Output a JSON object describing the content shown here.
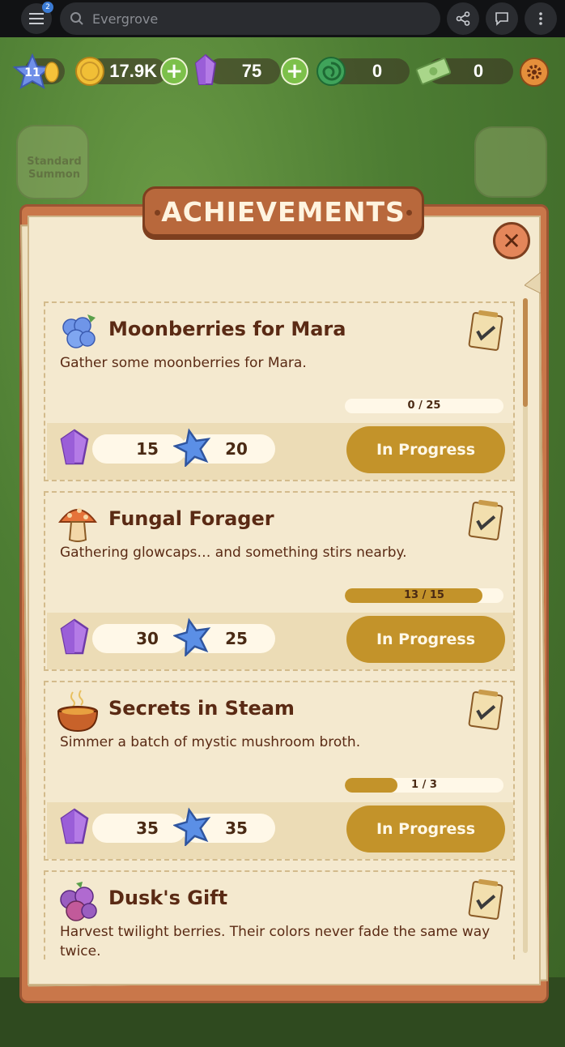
{
  "browser": {
    "menu_badge": "2",
    "search_text": "Evergrove"
  },
  "resources": {
    "level": "11",
    "coins": "17.9K",
    "gems": "75",
    "swirl": "0",
    "cash": "0"
  },
  "background": {
    "left_tile_label": "Standard Summon"
  },
  "modal": {
    "title": "ACHIEVEMENTS"
  },
  "achievements": [
    {
      "title": "Moonberries for Mara",
      "description": "Gather some moonberries for Mara.",
      "progress_text": "0 / 25",
      "progress_fraction": 0.0,
      "gem_reward": "15",
      "star_reward": "20",
      "status": "In Progress"
    },
    {
      "title": "Fungal Forager",
      "description": "Gathering glowcaps… and something stirs nearby.",
      "progress_text": "13 / 15",
      "progress_fraction": 0.867,
      "gem_reward": "30",
      "star_reward": "25",
      "status": "In Progress"
    },
    {
      "title": "Secrets in Steam",
      "description": "Simmer a batch of mystic mushroom broth.",
      "progress_text": "1 / 3",
      "progress_fraction": 0.333,
      "gem_reward": "35",
      "star_reward": "35",
      "status": "In Progress"
    },
    {
      "title": "Dusk's Gift",
      "description": "Harvest twilight berries. Their colors never fade the same way twice."
    }
  ],
  "colors": {
    "accent_gold": "#c3932a",
    "title_brown": "#5a2a14",
    "banner": "#b8683c",
    "paper": "#f4e9cf"
  }
}
